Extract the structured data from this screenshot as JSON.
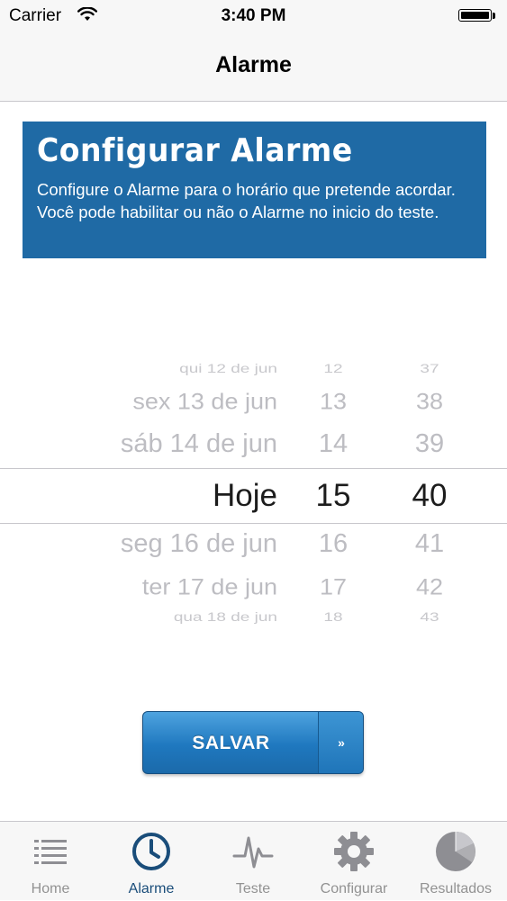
{
  "status_bar": {
    "carrier": "Carrier",
    "time": "3:40 PM"
  },
  "nav": {
    "title": "Alarme"
  },
  "info": {
    "title": "Configurar Alarme",
    "text": "Configure o Alarme para o horário que pretende acordar. Você pode habilitar ou não o Alarme no inicio do teste."
  },
  "picker": {
    "rows": [
      {
        "date": "qui 12 de jun",
        "hour": "12",
        "minute": "37"
      },
      {
        "date": "sex 13 de jun",
        "hour": "13",
        "minute": "38"
      },
      {
        "date": "sáb 14 de jun",
        "hour": "14",
        "minute": "39"
      },
      {
        "date": "Hoje",
        "hour": "15",
        "minute": "40"
      },
      {
        "date": "seg 16 de jun",
        "hour": "16",
        "minute": "41"
      },
      {
        "date": "ter 17 de jun",
        "hour": "17",
        "minute": "42"
      },
      {
        "date": "qua 18 de jun",
        "hour": "18",
        "minute": "43"
      }
    ]
  },
  "save_button": {
    "label": "SALVAR",
    "arrow": "»"
  },
  "tabs": [
    {
      "label": "Home",
      "icon": "list-icon"
    },
    {
      "label": "Alarme",
      "icon": "clock-icon"
    },
    {
      "label": "Teste",
      "icon": "heartbeat-icon"
    },
    {
      "label": "Configurar",
      "icon": "gear-icon"
    },
    {
      "label": "Resultados",
      "icon": "pie-chart-icon"
    }
  ],
  "active_tab": "Alarme",
  "colors": {
    "accent": "#1f6aa5",
    "button": "#1f78bf",
    "active_tab": "#1a4d7a"
  }
}
